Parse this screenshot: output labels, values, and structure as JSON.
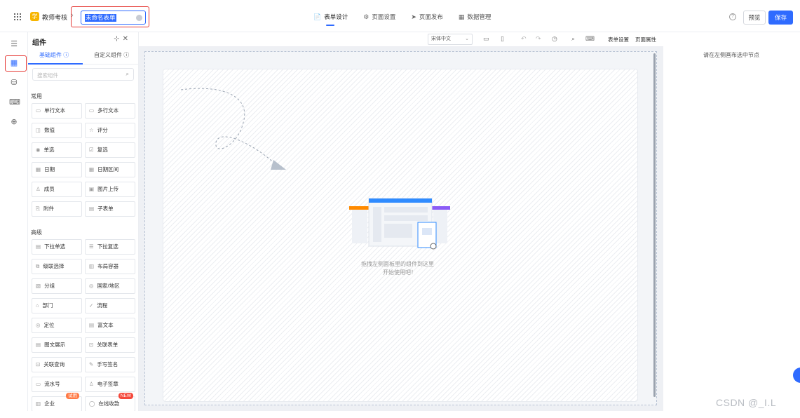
{
  "header": {
    "app_badge": "学",
    "app_name": "教师考核",
    "form_name": "未命名表单",
    "nav": [
      {
        "icon": "📄",
        "label": "表单设计"
      },
      {
        "icon": "⚙",
        "label": "页面设置"
      },
      {
        "icon": "➤",
        "label": "页面发布"
      },
      {
        "icon": "▦",
        "label": "数据管理"
      }
    ],
    "help": "?",
    "preview_label": "预览",
    "save_label": "保存"
  },
  "panel": {
    "title": "组件",
    "tools": "✕",
    "tabs": [
      "基础组件 ⓘ",
      "自定义组件 ⓘ"
    ],
    "search_placeholder": "搜索组件",
    "search_icon": "⌕",
    "sections": {
      "common": "常用",
      "advanced": "高级"
    },
    "common_items": [
      {
        "icon": "▭",
        "label": "单行文本"
      },
      {
        "icon": "▭",
        "label": "多行文本"
      },
      {
        "icon": "◫",
        "label": "数值"
      },
      {
        "icon": "☆",
        "label": "评分"
      },
      {
        "icon": "◉",
        "label": "单选"
      },
      {
        "icon": "☑",
        "label": "复选"
      },
      {
        "icon": "▦",
        "label": "日期"
      },
      {
        "icon": "▦",
        "label": "日期区间"
      },
      {
        "icon": "♙",
        "label": "成员"
      },
      {
        "icon": "▣",
        "label": "图片上传"
      },
      {
        "icon": "⎘",
        "label": "附件"
      },
      {
        "icon": "▤",
        "label": "子表单"
      }
    ],
    "advanced_items": [
      {
        "icon": "▤",
        "label": "下拉单选"
      },
      {
        "icon": "☰",
        "label": "下拉复选"
      },
      {
        "icon": "⧉",
        "label": "级联选择"
      },
      {
        "icon": "▥",
        "label": "布局容器"
      },
      {
        "icon": "▧",
        "label": "分组"
      },
      {
        "icon": "◎",
        "label": "国家/地区"
      },
      {
        "icon": "⌂",
        "label": "部门"
      },
      {
        "icon": "✓",
        "label": "流程"
      },
      {
        "icon": "◎",
        "label": "定位"
      },
      {
        "icon": "▤",
        "label": "富文本"
      },
      {
        "icon": "▤",
        "label": "图文展示"
      },
      {
        "icon": "⊡",
        "label": "关联表单"
      },
      {
        "icon": "⊡",
        "label": "关联查询"
      },
      {
        "icon": "✎",
        "label": "手写签名"
      },
      {
        "icon": "▭",
        "label": "流水号"
      },
      {
        "icon": "♙",
        "label": "电子签章"
      },
      {
        "icon": "▥",
        "label": "企业",
        "tag": "试用"
      },
      {
        "icon": "◯",
        "label": "在线收款",
        "tag": "NEW"
      }
    ]
  },
  "toolbar": {
    "font": "宋体中文",
    "chev": "⌄",
    "form_settings": "表单设置",
    "page_props": "页面属性"
  },
  "canvas": {
    "hint_line1": "拖拽左侧面板里的组件到这里",
    "hint_line2": "开始使用吧！"
  },
  "right_panel": {
    "message": "请在左侧画布选中节点"
  },
  "watermark": "CSDN @_I.L",
  "colors": {
    "accent": "#2f6bff",
    "highlight": "#e53935",
    "badge": "#f7b500"
  }
}
